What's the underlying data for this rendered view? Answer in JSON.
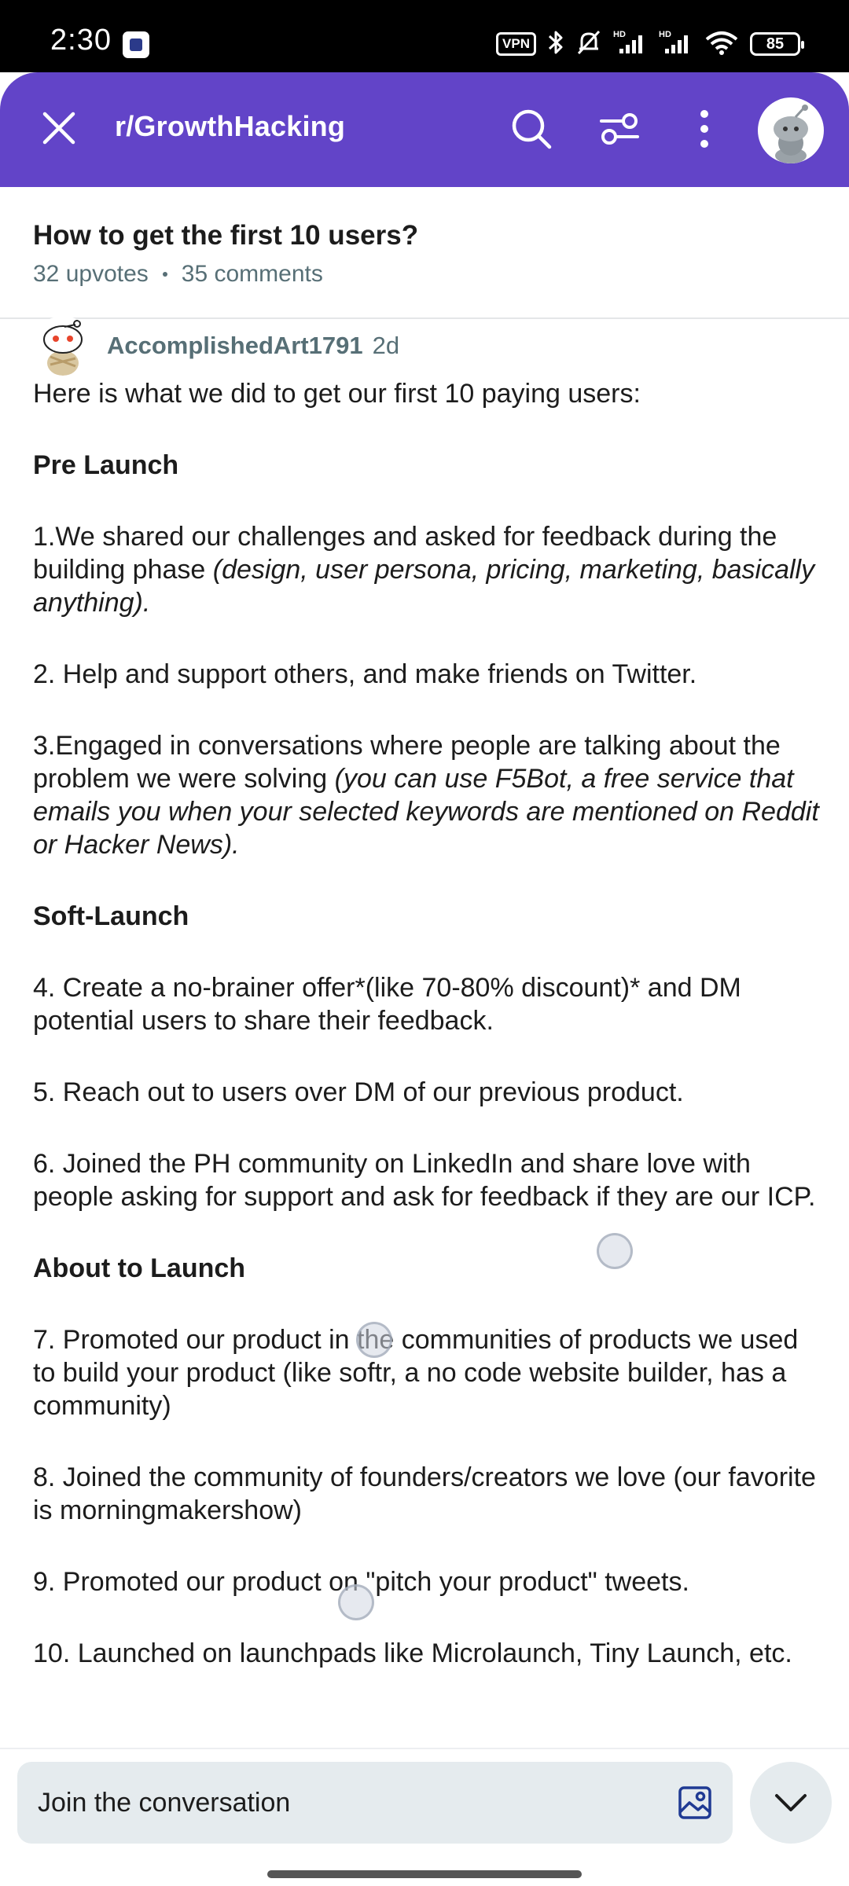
{
  "status_bar": {
    "time": "2:30",
    "vpn": "VPN",
    "battery": "85"
  },
  "header": {
    "subreddit": "r/GrowthHacking",
    "icons": [
      "close-icon",
      "search-icon",
      "sort-filter-icon",
      "more-vertical-icon",
      "avatar"
    ]
  },
  "post": {
    "title": "How to get the first 10 users?",
    "upvotes": "32 upvotes",
    "comments": "35 comments"
  },
  "comment": {
    "author": "AccomplishedArt1791",
    "age": "2d",
    "intro": "Here is what we did to get our first 10 paying users:",
    "pre_launch_heading": "Pre Launch",
    "item1_text": "1.We shared our challenges and asked for feedback during the building phase ",
    "item1_italic": "(design, user persona, pricing, marketing, basically anything).",
    "item2": "2. Help and support others, and make friends on Twitter.",
    "item3_text": "3.Engaged in conversations where people are talking about the problem we were solving ",
    "item3_italic": "(you can use F5Bot, a free service that emails you when your selected keywords are mentioned on Reddit or Hacker News).",
    "soft_launch_heading": "Soft-Launch",
    "item4": "4. Create a no-brainer offer*(like 70-80% discount)* and DM potential users to share their feedback.",
    "item5": "5. Reach out to users over DM of our previous product.",
    "item6": "6. Joined the PH community on LinkedIn and share love with people asking for support and ask for feedback if they are our ICP.",
    "about_launch_heading": "About to Launch",
    "item7": "7. Promoted our product in the communities of products we used to build your product (like softr, a no code website builder, has a community)",
    "item8": "8. Joined the community of founders/creators we love (our favorite is morningmakershow)",
    "item9": "9. Promoted our product on \"pitch your product\" tweets.",
    "item10": "10. Launched on launchpads like Microlaunch, Tiny Launch, etc."
  },
  "bottom": {
    "placeholder": "Join the conversation"
  },
  "colors": {
    "header_bg": "#6244c8",
    "meta_text": "#576f76",
    "input_bg": "#e5ebee"
  }
}
